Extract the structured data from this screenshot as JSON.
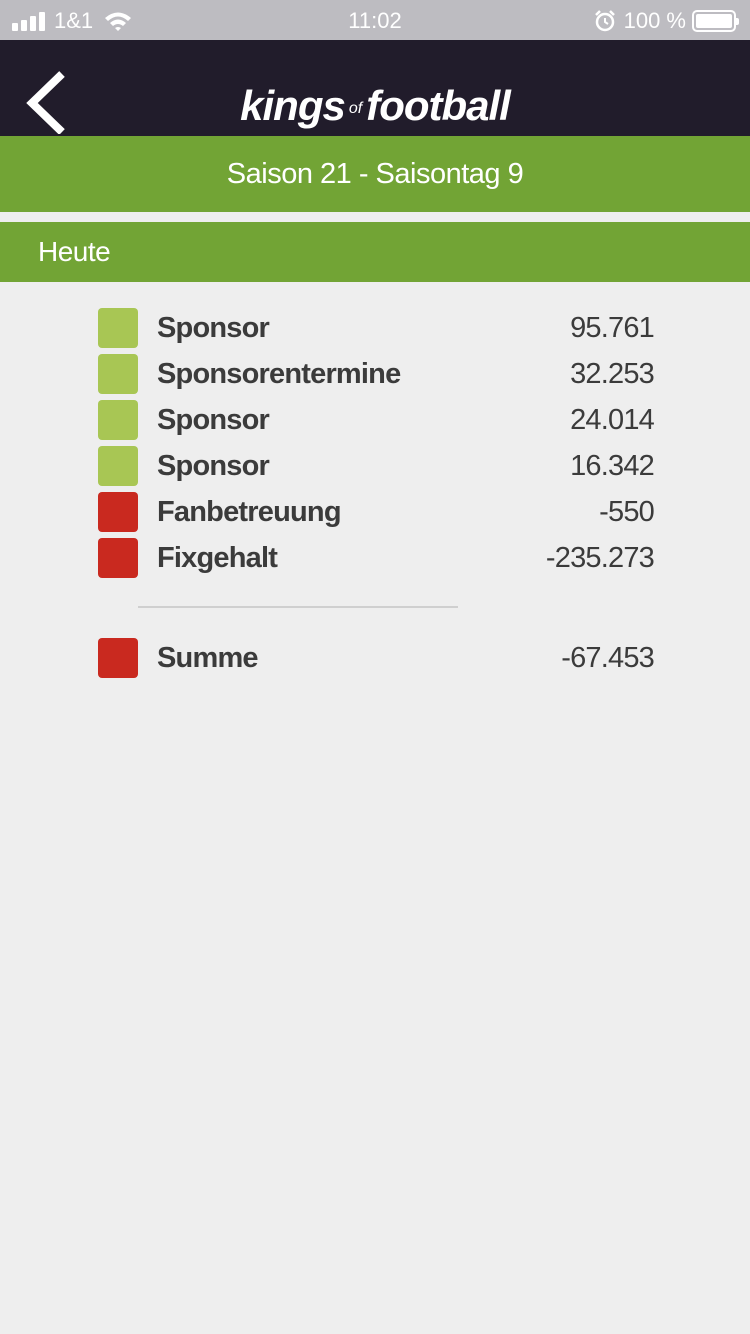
{
  "status_bar": {
    "carrier": "1&1",
    "time": "11:02",
    "battery": "100 %"
  },
  "header": {
    "logo_main_1": "kings",
    "logo_of": "of",
    "logo_main_2": "football",
    "season": "Saison 21 - Saisontag 9"
  },
  "section": {
    "title": "Heute"
  },
  "colors": {
    "positive": "#a8c654",
    "negative": "#c9291f",
    "accent_green": "#72a435",
    "nav_dark": "#211c2b"
  },
  "entries": [
    {
      "label": "Sponsor",
      "value": "95.761",
      "type": "positive"
    },
    {
      "label": "Sponsorentermine",
      "value": "32.253",
      "type": "positive"
    },
    {
      "label": "Sponsor",
      "value": "24.014",
      "type": "positive"
    },
    {
      "label": "Sponsor",
      "value": "16.342",
      "type": "positive"
    },
    {
      "label": "Fanbetreuung",
      "value": "-550",
      "type": "negative"
    },
    {
      "label": "Fixgehalt",
      "value": "-235.273",
      "type": "negative"
    }
  ],
  "total": {
    "label": "Summe",
    "value": "-67.453",
    "type": "negative"
  }
}
